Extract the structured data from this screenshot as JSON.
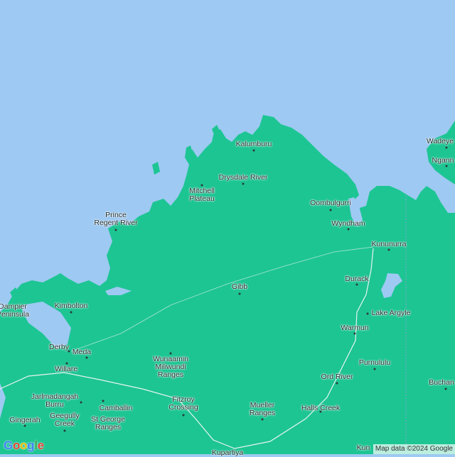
{
  "map": {
    "colors": {
      "water": "#9ec9f2",
      "land": "#1dc593",
      "border": "#7fa7c8"
    },
    "places": [
      {
        "id": "kalumburu",
        "text": "Kalumburu"
      },
      {
        "id": "drysdale-river",
        "text": "Drysdale River"
      },
      {
        "id": "mitchell-plateau",
        "text": "Mitchell\nPlateau"
      },
      {
        "id": "prince-regent-river",
        "text": "Prince\nRegent River"
      },
      {
        "id": "oombulgurri",
        "text": "Oombulgurri"
      },
      {
        "id": "wyndham",
        "text": "Wyndham"
      },
      {
        "id": "kununurra",
        "text": "Kununurra"
      },
      {
        "id": "durack",
        "text": "Durack"
      },
      {
        "id": "lake-argyle",
        "text": "Lake Argyle"
      },
      {
        "id": "warmun",
        "text": "Warmun"
      },
      {
        "id": "purnululu",
        "text": "Purnululu"
      },
      {
        "id": "ord-river",
        "text": "Ord River"
      },
      {
        "id": "halls-creek",
        "text": "Halls Creek"
      },
      {
        "id": "gibb",
        "text": "Gibb"
      },
      {
        "id": "dampier-peninsula",
        "text": "Dampier\nPeninsula"
      },
      {
        "id": "kimbolton",
        "text": "Kimbolton"
      },
      {
        "id": "derby",
        "text": "Derby"
      },
      {
        "id": "meda",
        "text": "Meda"
      },
      {
        "id": "willare",
        "text": "Willare"
      },
      {
        "id": "wunaamin-miliwundi-ranges",
        "text": "Wunaamin\nMiliwundi\nRanges"
      },
      {
        "id": "fitzroy-crossing",
        "text": "Fitzroy\nCrossing"
      },
      {
        "id": "mueller-ranges",
        "text": "Mueller\nRanges"
      },
      {
        "id": "jarlmadangah-burru",
        "text": "Jarlmadangah\nBurru"
      },
      {
        "id": "camballin",
        "text": "Camballin"
      },
      {
        "id": "gingerah",
        "text": "Gingerah"
      },
      {
        "id": "geegully-creek",
        "text": "Geegully\nCreek"
      },
      {
        "id": "st-george-ranges",
        "text": "St George\nRanges"
      },
      {
        "id": "wadeye",
        "text": "Wadeye"
      },
      {
        "id": "nganmarriyanga",
        "text": "Ngann"
      },
      {
        "id": "buchanan",
        "text": "Buchan"
      },
      {
        "id": "kupartiya",
        "text": "Kupartiya"
      },
      {
        "id": "kundat-djaru",
        "text": "Kun"
      }
    ]
  },
  "logo": "Google",
  "attribution": "Map data ©2024 Google"
}
